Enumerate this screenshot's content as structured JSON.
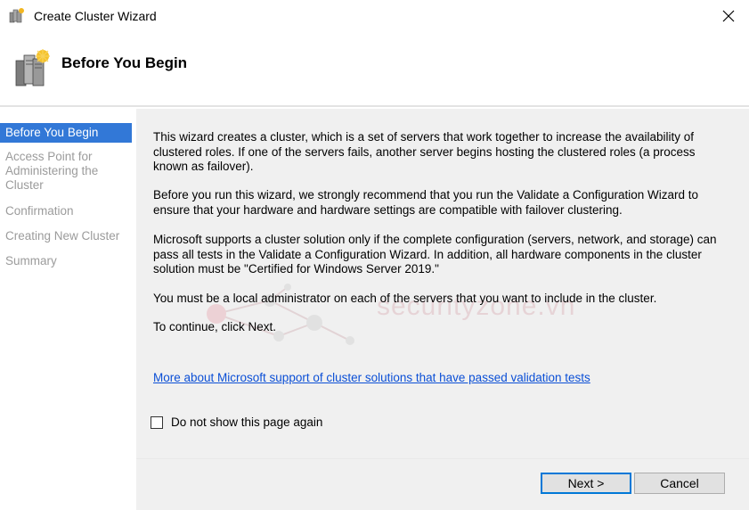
{
  "window": {
    "title": "Create Cluster Wizard",
    "close_icon": "close-icon"
  },
  "header": {
    "heading": "Before You Begin",
    "icon": "cluster-servers-icon"
  },
  "sidebar": {
    "items": [
      {
        "label": "Before You Begin",
        "active": true
      },
      {
        "label": "Access Point for Administering the Cluster",
        "lines": [
          "Access Point for",
          "Administering the",
          "Cluster"
        ],
        "active": false
      },
      {
        "label": "Confirmation",
        "active": false
      },
      {
        "label": "Creating New Cluster",
        "active": false
      },
      {
        "label": "Summary",
        "active": false
      }
    ]
  },
  "main": {
    "paragraphs": [
      "This wizard creates a cluster, which is a set of servers that work together to increase the availability of clustered roles. If one of the servers fails, another server begins hosting the clustered roles (a process known as failover).",
      "Before you run this wizard, we strongly recommend that you run the Validate a Configuration Wizard to ensure that your hardware and hardware settings are compatible with failover clustering.",
      "Microsoft supports a cluster solution only if the complete configuration (servers, network, and storage) can pass all tests in the Validate a Configuration Wizard. In addition, all hardware components in the cluster solution must be \"Certified for Windows Server 2019.\"",
      "You must be a local administrator on each of the servers that you want to include in the cluster.",
      "To continue, click Next."
    ],
    "link": "More about Microsoft support of cluster solutions that have passed validation tests",
    "checkbox_label": "Do not show this page again",
    "checkbox_checked": false,
    "watermark": "securityzone.vn"
  },
  "buttons": {
    "next": "Next >",
    "cancel": "Cancel"
  },
  "colors": {
    "accent": "#3278d7",
    "link": "#0b4fd6",
    "content_bg": "#f0f0f0"
  }
}
